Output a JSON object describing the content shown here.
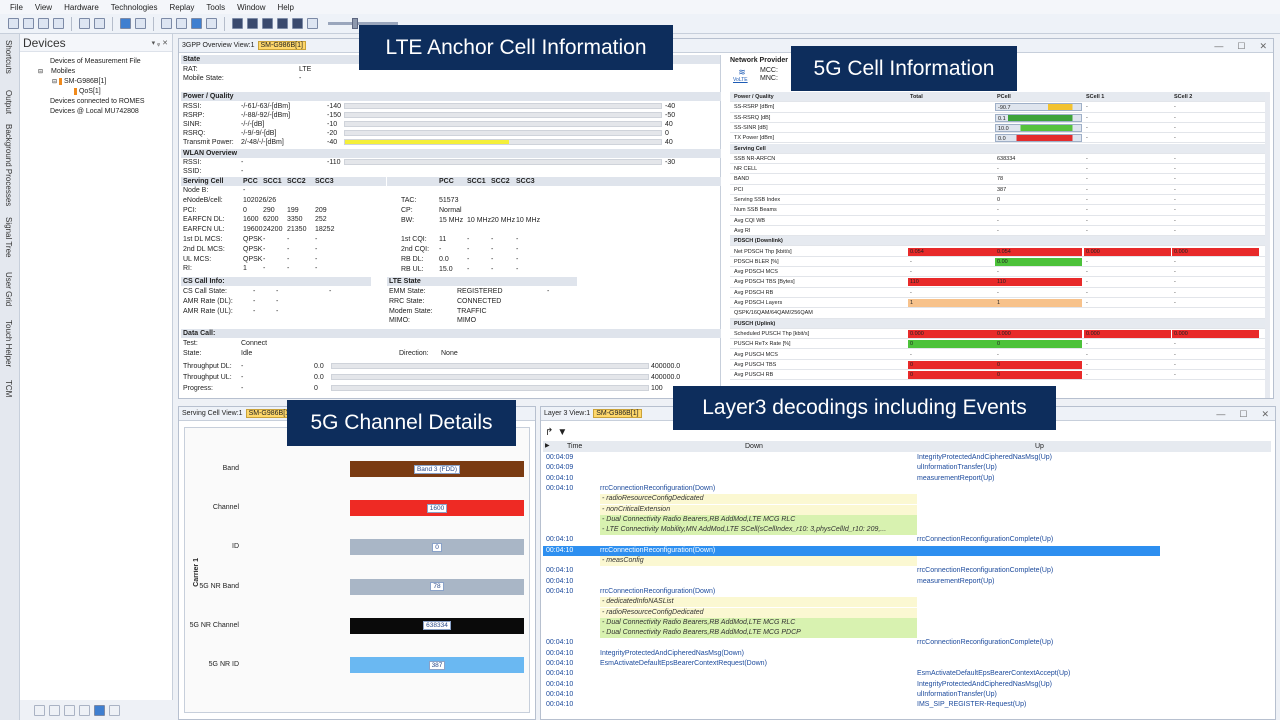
{
  "menu": [
    "File",
    "View",
    "Hardware",
    "Technologies",
    "Replay",
    "Tools",
    "Window",
    "Help"
  ],
  "left_tabs": [
    "Shortcuts",
    "Output",
    "Background Processes",
    "Signal Tree",
    "User Grid",
    "Touch Helper",
    "TCM"
  ],
  "devices": {
    "title": "Devices",
    "pin": "▾ ᵩ ✕",
    "tree": [
      "Devices of Measurement File",
      "Mobiles",
      "SM-G986B[1]",
      "QoS[1]",
      "Devices connected to ROMES",
      "Devices @ Local MU742808"
    ]
  },
  "callouts": {
    "lte": "LTE Anchor Cell Information",
    "nr": "5G Cell Information",
    "chan": "5G Channel Details",
    "l3": "Layer3 decodings including Events"
  },
  "lte_view": {
    "tab": "3GPP Overview View:1",
    "tab_device": "SM-G986B[1]",
    "state_h": "State",
    "rat_l": "RAT:",
    "rat_v": "LTE",
    "ms_l": "Mobile State:",
    "ms_v": "-",
    "pq_h": "Power / Quality",
    "pq": [
      {
        "l": "RSSI:",
        "v": "-/-61/-63/-[dBm]",
        "n": "-140",
        "r": "-40"
      },
      {
        "l": "RSRP:",
        "v": "-/-88/-92/-[dBm]",
        "n": "-150",
        "r": "-50"
      },
      {
        "l": "SINR:",
        "v": "-/-/-[dB]",
        "n": "-10",
        "r": "40"
      },
      {
        "l": "RSRQ:",
        "v": "-/-9/-9/-[dB]",
        "n": "-20",
        "r": "0"
      },
      {
        "l": "Transmit Power:",
        "v": "2/-48/-/-[dBm]",
        "n": "-40",
        "r": "40"
      }
    ],
    "wlan_h": "WLAN Overview",
    "wlan": [
      {
        "l": "RSSI:",
        "v": "-",
        "n": "-110",
        "r": "-30"
      },
      {
        "l": "SSID:",
        "v": "-"
      }
    ],
    "sc_h": [
      "Serving Cell",
      "PCC",
      "SCC1",
      "SCC2",
      "SCC3"
    ],
    "sc_rows": [
      [
        "Node B:",
        "-",
        "",
        "",
        ""
      ],
      [
        "eNodeB/cell:",
        "102026/26",
        "",
        "",
        ""
      ],
      [
        "PCI:",
        "0",
        "290",
        "199",
        "209"
      ],
      [
        "EARFCN DL:",
        "1600",
        "6200",
        "3350",
        "252"
      ],
      [
        "EARFCN UL:",
        "19600",
        "24200",
        "21350",
        "18252"
      ],
      [
        "1st DL MCS:",
        "QPSK",
        "-",
        "-",
        "-"
      ],
      [
        "2nd DL MCS:",
        "QPSK",
        "-",
        "-",
        "-"
      ],
      [
        "UL MCS:",
        "QPSK",
        "-",
        "-",
        "-"
      ],
      [
        "RI:",
        "1",
        "-",
        "-",
        "-"
      ]
    ],
    "sc2_h": [
      "PCC",
      "SCC1",
      "SCC2",
      "SCC3"
    ],
    "sc2_rows": [
      [
        "TAC:",
        "51573",
        "",
        "",
        ""
      ],
      [
        "CP:",
        "Normal",
        "",
        "",
        ""
      ],
      [
        "BW:",
        "15 MHz",
        "10 MHz",
        "20 MHz",
        "10 MHz"
      ],
      [
        "",
        ""
      ],
      [
        "1st CQI:",
        "11",
        "-",
        "-",
        "-"
      ],
      [
        "2nd CQI:",
        "-",
        "-",
        "-",
        "-"
      ],
      [
        "RB DL:",
        "0.0",
        "-",
        "-",
        "-"
      ],
      [
        "RB UL:",
        "15.0",
        "-",
        "-",
        "-"
      ]
    ],
    "cs_h": "CS Call Info:",
    "cs": [
      [
        "CS Call State:",
        "-",
        "-",
        "-"
      ],
      [
        "AMR Rate (DL):",
        "-",
        "-",
        ""
      ],
      [
        "AMR Rate (UL):",
        "-",
        "-",
        ""
      ]
    ],
    "lte_h": "LTE State",
    "lte_state": [
      [
        "EMM State:",
        "REGISTERED",
        "-"
      ],
      [
        "RRC State:",
        "CONNECTED",
        ""
      ],
      [
        "Modem State:",
        "TRAFFIC",
        ""
      ],
      [
        "MIMO:",
        "MIMO",
        ""
      ]
    ],
    "dc_h": "Data Call:",
    "dc": [
      [
        "Test:",
        "Connect"
      ],
      [
        "State:",
        "Idle"
      ]
    ],
    "dir_l": "Direction:",
    "dir_v": "None",
    "tp": [
      {
        "l": "Throughput DL:",
        "v": "-",
        "n": "0.0",
        "r": "400000.0"
      },
      {
        "l": "Throughput UL:",
        "v": "-",
        "n": "0.0",
        "r": "400000.0"
      },
      {
        "l": "Progress:",
        "v": "-",
        "n": "0",
        "r": "100"
      }
    ]
  },
  "nr_view": {
    "np_h": "Network Provider",
    "mcc": "MCC:",
    "mnc": "MNC:",
    "volte": "VoLTE",
    "cols": [
      "Power / Quality",
      "Total",
      "PCell",
      "SCell 1",
      "SCell 2"
    ],
    "rows": [
      {
        "l": "SS-RSRP [dBm]",
        "t": "",
        "p": "-90.7",
        "s1": "-",
        "s2": "-",
        "pc": "#f2c230",
        "pw": 0.62
      },
      {
        "l": "SS-RSRQ [dB]",
        "t": "",
        "p": "0.1",
        "s1": "-",
        "s2": "-",
        "pc": "#3ea33a",
        "pw": 0.15
      },
      {
        "l": "SS-SINR [dB]",
        "t": "",
        "p": "10.0",
        "s1": "-",
        "s2": "-",
        "pc": "#56c23d",
        "pw": 0.3
      },
      {
        "l": "TX Power [dBm]",
        "t": "",
        "p": "0.0",
        "s1": "-",
        "s2": "-",
        "pc": "#e32b2b",
        "pw": 0.25
      },
      {
        "l": "Serving Cell",
        "sh": true
      },
      {
        "l": "SSB NR-ARFCN",
        "t": "",
        "p": "638334",
        "s1": "-",
        "s2": "-"
      },
      {
        "l": "NR CELL",
        "t": "",
        "p": "-",
        "s1": "-",
        "s2": "-"
      },
      {
        "l": "BAND",
        "t": "",
        "p": "78",
        "s1": "-",
        "s2": "-"
      },
      {
        "l": "PCI",
        "t": "",
        "p": "387",
        "s1": "-",
        "s2": "-"
      },
      {
        "l": "Serving SSB Index",
        "t": "",
        "p": "0",
        "s1": "-",
        "s2": "-"
      },
      {
        "l": "Num SSB Beams",
        "t": "",
        "p": "-",
        "s1": "-",
        "s2": "-"
      },
      {
        "l": "Avg CQI WB",
        "t": "",
        "p": "-",
        "s1": "-",
        "s2": "-"
      },
      {
        "l": "Avg RI",
        "t": "",
        "p": "-",
        "s1": "-",
        "s2": "-"
      },
      {
        "l": "PDSCH (Downlink)",
        "sh": true
      },
      {
        "l": "Net PDSCH Thp [kbit/s]",
        "t": "0.054",
        "p": "0.054",
        "s1": "0.000",
        "s2": "0.000",
        "tc": "#e82a2a",
        "pc": "#e82a2a",
        "s1c": "#e82a2a",
        "s2c": "#e82a2a"
      },
      {
        "l": "PDSCH BLER [%]",
        "t": "-",
        "p": "0.00",
        "s1": "-",
        "s2": "-",
        "pc": "#4cc23a"
      },
      {
        "l": "Avg PDSCH MCS",
        "t": "-",
        "p": "-",
        "s1": "-",
        "s2": "-"
      },
      {
        "l": "Avg PDSCH TBS [Bytes]",
        "t": "110",
        "p": "110",
        "s1": "-",
        "s2": "-",
        "tc": "#e82a2a",
        "pc": "#e82a2a"
      },
      {
        "l": "Avg PDSCH RB",
        "t": "-",
        "p": "-",
        "s1": "-",
        "s2": "-"
      },
      {
        "l": "Avg PDSCH Layers",
        "t": "1",
        "p": "1",
        "s1": "-",
        "s2": "-",
        "tc": "#f7c28b",
        "pc": "#f7c28b"
      },
      {
        "l": "QSPK/16QAM/64QAM/256QAM",
        "t": "",
        "p": "",
        "s1": "",
        "s2": ""
      },
      {
        "l": "PUSCH (Uplink)",
        "sh": true
      },
      {
        "l": "Scheduled PUSCH Thp [kbit/s]",
        "t": "0.000",
        "p": "0.000",
        "s1": "0.000",
        "s2": "0.000",
        "tc": "#e82a2a",
        "pc": "#e82a2a",
        "s1c": "#e82a2a",
        "s2c": "#e82a2a"
      },
      {
        "l": "PUSCH ReTx Rate [%]",
        "t": "0",
        "p": "0",
        "s1": "-",
        "s2": "-",
        "tc": "#4cc23a",
        "pc": "#4cc23a"
      },
      {
        "l": "Avg PUSCH MCS",
        "t": "-",
        "p": "-",
        "s1": "-",
        "s2": "-"
      },
      {
        "l": "Avg PUSCH TBS",
        "t": "0",
        "p": "0",
        "s1": "-",
        "s2": "-",
        "tc": "#e82a2a",
        "pc": "#e82a2a"
      },
      {
        "l": "Avg PUSCH RB",
        "t": "0",
        "p": "0",
        "s1": "-",
        "s2": "-",
        "tc": "#e82a2a",
        "pc": "#e82a2a"
      }
    ]
  },
  "sc_view": {
    "tab": "Serving Cell View:1",
    "tab_device": "SM-G986B[1]",
    "carrier": "Carrier 1",
    "bands": [
      {
        "l": "Band",
        "v": "Band 3 (FDD)",
        "c": "#7a3b12"
      },
      {
        "l": "Channel",
        "v": "1600",
        "c": "#ee2a24"
      },
      {
        "l": "ID",
        "v": "0",
        "c": "#a9b6c6"
      },
      {
        "l": "5G NR Band",
        "v": "78",
        "c": "#a9b6c6"
      },
      {
        "l": "5G NR Channel",
        "v": "638334",
        "c": "#0a0a0a"
      },
      {
        "l": "5G NR ID",
        "v": "387",
        "c": "#6ab8f2"
      }
    ]
  },
  "l3_view": {
    "tab": "Layer 3 View:1",
    "tab_device": "SM-G986B[1]",
    "cols": [
      "Time",
      "Down",
      "Up"
    ],
    "rows": [
      {
        "t": "00:04:09",
        "u": "IntegrityProtectedAndCipheredNasMsg(Up)"
      },
      {
        "t": "00:04:09",
        "u": "ulInformationTransfer(Up)"
      },
      {
        "t": "00:04:10",
        "u": "measurementReport(Up)"
      },
      {
        "t": "00:04:10",
        "d": "rrcConnectionReconfiguration(Down)"
      },
      {
        "s": "- radioResourceConfigDedicated",
        "bg": "#fbf8d2"
      },
      {
        "s": "- nonCriticalExtension",
        "bg": "#fbf8d2"
      },
      {
        "s": "- Dual Connectivity Radio Bearers,RB AddMod,LTE MCG RLC",
        "bg": "#d8f2b0"
      },
      {
        "s": "- LTE Connectivity Mobility,MN AddMod,LTE SCell(sCellIndex_r10: 3,physCellId_r10: 209,...",
        "bg": "#d8f2b0"
      },
      {
        "t": "00:04:10",
        "u": "rrcConnectionReconfigurationComplete(Up)"
      },
      {
        "t": "00:04:10",
        "d": "rrcConnectionReconfiguration(Down)",
        "sel": true
      },
      {
        "s": "- measConfig",
        "bg": "#fbf8d2"
      },
      {
        "t": "00:04:10",
        "u": "rrcConnectionReconfigurationComplete(Up)"
      },
      {
        "t": "00:04:10",
        "u": "measurementReport(Up)"
      },
      {
        "t": "00:04:10",
        "d": "rrcConnectionReconfiguration(Down)"
      },
      {
        "s": "- dedicatedInfoNASList",
        "bg": "#fbf8d2"
      },
      {
        "s": "- radioResourceConfigDedicated",
        "bg": "#fbf8d2"
      },
      {
        "s": "- Dual Connectivity Radio Bearers,RB AddMod,LTE MCG RLC",
        "bg": "#d8f2b0"
      },
      {
        "s": "- Dual Connectivity Radio Bearers,RB AddMod,LTE MCG PDCP",
        "bg": "#d8f2b0"
      },
      {
        "t": "00:04:10",
        "u": "rrcConnectionReconfigurationComplete(Up)"
      },
      {
        "t": "00:04:10",
        "d": "IntegrityProtectedAndCipheredNasMsg(Down)"
      },
      {
        "t": "00:04:10",
        "d": "EsmActivateDefaultEpsBearerContextRequest(Down)"
      },
      {
        "t": "00:04:10",
        "u": "EsmActivateDefaultEpsBearerContextAccept(Up)"
      },
      {
        "t": "00:04:10",
        "u": "IntegrityProtectedAndCipheredNasMsg(Up)"
      },
      {
        "t": "00:04:10",
        "u": "ulInformationTransfer(Up)"
      },
      {
        "t": "00:04:10",
        "u": "IMS_SIP_REGISTER-Request(Up)"
      }
    ]
  }
}
